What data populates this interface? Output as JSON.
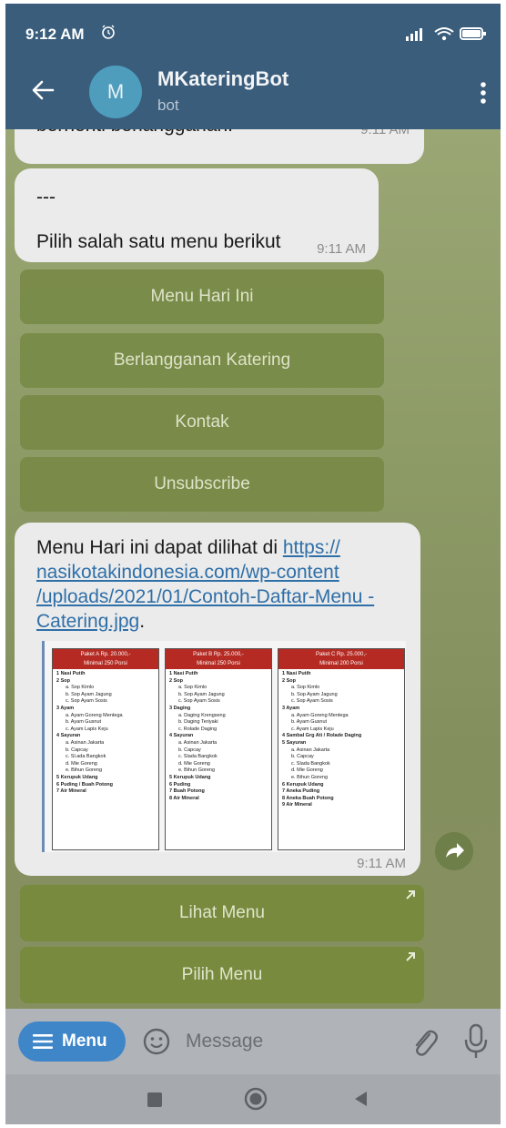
{
  "status_bar": {
    "time": "9:12 AM"
  },
  "header": {
    "avatar_letter": "M",
    "title": "MKateringBot",
    "subtitle": "bot"
  },
  "messages": [
    {
      "text": "berhenti berlangganan.",
      "time": "9:11 AM"
    },
    {
      "line1": "---",
      "line2": "Pilih salah satu menu berikut",
      "time": "9:11 AM"
    },
    {
      "text_prefix": "Menu Hari ini dapat dilihat di ",
      "link": "https://nasikotakindonesia.com/wp-content/uploads/2021/01/Contoh-Daftar-Menu-Catering.jpg",
      "link_display": "https:// nasikotakindonesia.com/wp-content /uploads/2021/01/Contoh-Daftar-Menu -Catering.jpg",
      "text_suffix": ".",
      "time": "9:11 AM"
    }
  ],
  "inline_keyboard": [
    "Menu Hari Ini",
    "Berlangganan Katering",
    "Kontak",
    "Unsubscribe"
  ],
  "url_buttons": [
    "Lihat Menu",
    "Pilih Menu"
  ],
  "menu_preview": [
    {
      "header": "Paket A Rp. 20.000,-",
      "sub": "Minimal 250 Porsi",
      "items": [
        {
          "t": "1  Nasi Putih",
          "k": "main"
        },
        {
          "t": "2  Sop",
          "k": "main"
        },
        {
          "t": "a. Sop Kimlo",
          "k": "sub"
        },
        {
          "t": "b. Sop Ayam Jagung",
          "k": "sub"
        },
        {
          "t": "c. Sop Ayam Sosis",
          "k": "sub"
        },
        {
          "t": "3  Ayam",
          "k": "main"
        },
        {
          "t": "a. Ayam Goreng Mentega",
          "k": "sub"
        },
        {
          "t": "b. Ayam Gusnut",
          "k": "sub"
        },
        {
          "t": "c. Ayam Lapis Keju",
          "k": "sub"
        },
        {
          "t": "4  Sayuran",
          "k": "main"
        },
        {
          "t": "a. Asinan Jakarta",
          "k": "sub"
        },
        {
          "t": "b. Capcay",
          "k": "sub"
        },
        {
          "t": "c. Sl.ada Bangkok",
          "k": "sub"
        },
        {
          "t": "d. Mie Goreng",
          "k": "sub"
        },
        {
          "t": "e. Bihun Goreng",
          "k": "sub"
        },
        {
          "t": "5  Kerupuk Udang",
          "k": "main"
        },
        {
          "t": "6  Puding / Buah Potong",
          "k": "main"
        },
        {
          "t": "7  Air Mineral",
          "k": "main"
        }
      ]
    },
    {
      "header": "Paket B Rp. 25.000,-",
      "sub": "Minimal 250 Porsi",
      "items": [
        {
          "t": "1  Nasi Putih",
          "k": "main"
        },
        {
          "t": "2  Sop",
          "k": "main"
        },
        {
          "t": "a. Sop Kimlo",
          "k": "sub"
        },
        {
          "t": "b. Sop Ayam Jagung",
          "k": "sub"
        },
        {
          "t": "c. Sop Ayam Sosis",
          "k": "sub"
        },
        {
          "t": "3  Daging",
          "k": "main"
        },
        {
          "t": "a. Daging Krengseng",
          "k": "sub"
        },
        {
          "t": "b. Daging Teriyaki",
          "k": "sub"
        },
        {
          "t": "c. Rolade Daging",
          "k": "sub"
        },
        {
          "t": "4  Sayuran",
          "k": "main"
        },
        {
          "t": "a. Asinan Jakarta",
          "k": "sub"
        },
        {
          "t": "b. Capcay",
          "k": "sub"
        },
        {
          "t": "c. Slada Bangkok",
          "k": "sub"
        },
        {
          "t": "d. Mie Goreng",
          "k": "sub"
        },
        {
          "t": "e. Bihun Goreng",
          "k": "sub"
        },
        {
          "t": "5  Kerupuk Udang",
          "k": "main"
        },
        {
          "t": "6  Puding",
          "k": "main"
        },
        {
          "t": "7  Buah Potong",
          "k": "main"
        },
        {
          "t": "8  Air Mineral",
          "k": "main"
        }
      ]
    },
    {
      "header": "Paket C Rp. 25.000,-",
      "sub": "Minimal 200 Porsi",
      "items": [
        {
          "t": "1  Nasi Putih",
          "k": "main"
        },
        {
          "t": "2  Sop",
          "k": "main"
        },
        {
          "t": "a. Sop Kimlo",
          "k": "sub"
        },
        {
          "t": "b. Sop Ayam Jagung",
          "k": "sub"
        },
        {
          "t": "c. Sop Ayam Sosis",
          "k": "sub"
        },
        {
          "t": "3  Ayam",
          "k": "main"
        },
        {
          "t": "a. Ayam Goreng Mentega",
          "k": "sub"
        },
        {
          "t": "b. Ayam Gusnut",
          "k": "sub"
        },
        {
          "t": "c. Ayam Lapis Keju",
          "k": "sub"
        },
        {
          "t": "4  Sambal Grg Ati / Rolade Daging",
          "k": "main"
        },
        {
          "t": "5  Sayuran",
          "k": "main"
        },
        {
          "t": "a. Asinan Jakarta",
          "k": "sub"
        },
        {
          "t": "b. Capcay",
          "k": "sub"
        },
        {
          "t": "c. Slada Bangkok",
          "k": "sub"
        },
        {
          "t": "d. Mie Goreng",
          "k": "sub"
        },
        {
          "t": "e. Bihun Goreng",
          "k": "sub"
        },
        {
          "t": "6  Kerupuk Udang",
          "k": "main"
        },
        {
          "t": "7  Aneka Puding",
          "k": "main"
        },
        {
          "t": "8  Aneka Buah Potong",
          "k": "main"
        },
        {
          "t": "9  Air Mineral",
          "k": "main"
        }
      ]
    }
  ],
  "input_bar": {
    "menu_label": "Menu",
    "placeholder": "Message"
  },
  "icons": {
    "alarm": "alarm-icon",
    "signal": "signal-icon",
    "wifi": "wifi-icon",
    "battery": "battery-icon",
    "back": "back-arrow-icon",
    "more": "more-vertical-icon",
    "share": "share-icon",
    "emoji": "emoji-icon",
    "attach": "paperclip-icon",
    "mic": "microphone-icon",
    "url_arrow": "arrow-up-right-icon",
    "hamburger": "hamburger-icon"
  },
  "colors": {
    "header_bg": "#3a5d7c",
    "bubble_bg": "#ebebeb",
    "link": "#2f6fa8",
    "keyboard_button": "#788a46",
    "menu_button": "#3f86c9",
    "menu_header_red": "#b52a22"
  }
}
